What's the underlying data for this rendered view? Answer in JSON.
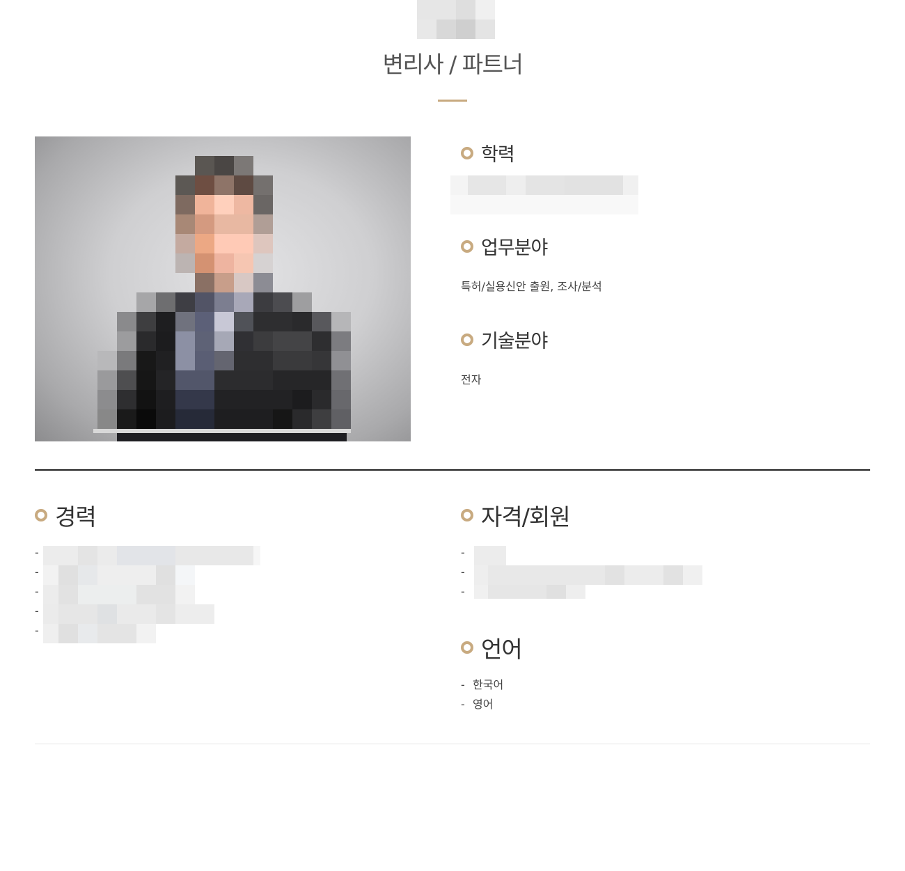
{
  "header": {
    "title": "변리사 / 파트너"
  },
  "profile": {
    "education": {
      "heading": "학력"
    },
    "practice": {
      "heading": "업무분야",
      "text": "특허/실용신안 출원, 조사/분석"
    },
    "technology": {
      "heading": "기술분야",
      "text": "전자"
    }
  },
  "career": {
    "heading": "경력",
    "items": [
      {
        "dash": "-"
      },
      {
        "dash": "-"
      },
      {
        "dash": "-"
      },
      {
        "dash": "-"
      },
      {
        "dash": "-"
      }
    ]
  },
  "qualifications": {
    "heading": "자격/회원",
    "items": [
      {
        "dash": "-"
      },
      {
        "dash": "-"
      },
      {
        "dash": "-"
      }
    ]
  },
  "languages": {
    "heading": "언어",
    "items": [
      {
        "dash": "-",
        "text": "한국어"
      },
      {
        "dash": "-",
        "text": "영어"
      }
    ]
  },
  "colors": {
    "accent": "#c8aa80",
    "divider": "#222222",
    "text": "#333333"
  },
  "icons": {
    "section_bullet": "ring-bullet-icon"
  }
}
